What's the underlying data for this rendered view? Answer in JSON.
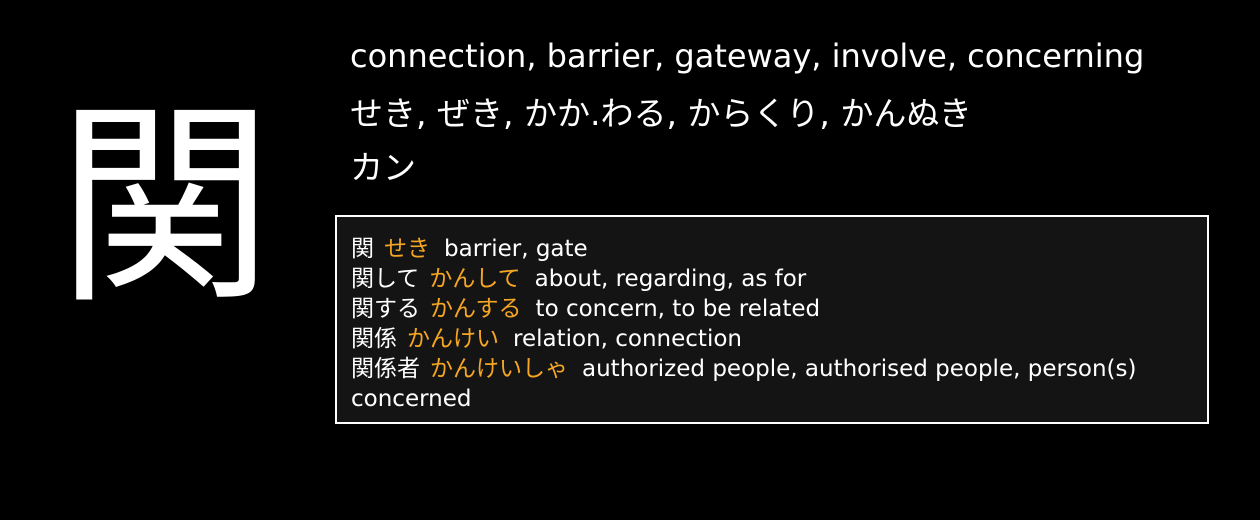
{
  "kanji": {
    "character": "関",
    "meanings": "connection, barrier, gateway, involve, concerning",
    "kun_readings": "せき, ぜき, かか.わる, からくり, かんぬき",
    "on_readings": "カン"
  },
  "vocabulary": [
    {
      "word": "関",
      "reading": "せき",
      "gloss": "barrier, gate"
    },
    {
      "word": "関して",
      "reading": "かんして",
      "gloss": "about, regarding, as for"
    },
    {
      "word": "関する",
      "reading": "かんする",
      "gloss": "to concern, to be related"
    },
    {
      "word": "関係",
      "reading": "かんけい",
      "gloss": "relation, connection"
    },
    {
      "word": "関係者",
      "reading": "かんけいしゃ",
      "gloss": "authorized people, authorised people, person(s) concerned"
    }
  ],
  "colors": {
    "background": "#000000",
    "box_background": "#141414",
    "box_border": "#ffffff",
    "reading": "#f5a623",
    "text": "#ffffff"
  }
}
